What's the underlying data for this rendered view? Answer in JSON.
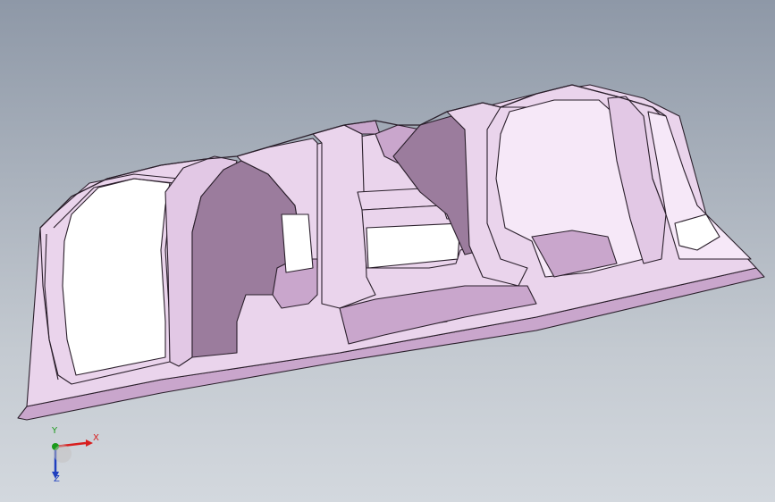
{
  "viewport": {
    "background_top": "#8e98a7",
    "background_bottom": "#d3d8de"
  },
  "model": {
    "face_color": "#ead4ec",
    "face_shade": "#c9a6cc",
    "face_dark": "#9b7c9d",
    "face_light": "#f8eefa",
    "edge_color": "#2a1f2b"
  },
  "triad": {
    "x_label": "X",
    "y_label": "Y",
    "z_label": "Z",
    "x_color": "#d81e1e",
    "y_color": "#1a9a1a",
    "z_color": "#1f3fbf"
  }
}
